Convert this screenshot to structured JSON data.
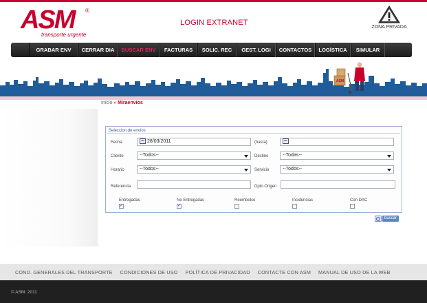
{
  "header": {
    "logo_text": "ASM",
    "logo_reg": "®",
    "logo_tagline": "transporte urgente",
    "title": "LOGIN EXTRANET",
    "zona_label": "ZONA PRIVADA",
    "zona_icon": "warning-icon"
  },
  "nav": {
    "items": [
      {
        "label": "GRABAR ENV",
        "active": false
      },
      {
        "label": "CERRAR DIA",
        "active": false
      },
      {
        "label": "BUSCAR ENV",
        "active": true
      },
      {
        "label": "FACTURAS",
        "active": false
      },
      {
        "label": "SOLIC. REC",
        "active": false
      },
      {
        "label": "GEST. LOGI",
        "active": false
      },
      {
        "label": "CONTACTOS",
        "active": false
      },
      {
        "label": "LOGÍSTICA",
        "active": false
      },
      {
        "label": "SIMULAR",
        "active": false
      }
    ]
  },
  "breadcrumb": {
    "home": "Inicio",
    "separator": "»",
    "current": "Miraenvios"
  },
  "form": {
    "legend": "Seleccion de envíos",
    "fecha_label": "Fecha",
    "fecha_value": "28/03/2011",
    "hasta_label": "(hasta)",
    "hasta_value": "",
    "cliente_label": "Cliente",
    "cliente_value": "--Todos--",
    "destino_label": "Destino",
    "destino_value": "--Todas--",
    "horario_label": "Horario",
    "horario_value": "--Todos--",
    "servicio_label": "Servicio",
    "servicio_value": "--Todos--",
    "referencia_label": "Referencia",
    "referencia_value": "",
    "dpto_label": "Dpto Origen",
    "dpto_value": "",
    "checkboxes": [
      {
        "label": "Entregadas",
        "checked": true
      },
      {
        "label": "No Entregadas",
        "checked": true
      },
      {
        "label": "Reembolso",
        "checked": false
      },
      {
        "label": "Incidencias",
        "checked": false
      },
      {
        "label": "Con DAC",
        "checked": false
      }
    ],
    "search_button": "buscar"
  },
  "footer": {
    "links": [
      "COND. GENERALES DEL TRANSPORTE",
      "CONDICIONES DE USO",
      "POLÍTICA DE PRIVACIDAD",
      "CONTACTE CON ASM",
      "MANUAL DE USO DE LA WEB"
    ],
    "copyright": "© ASM. 2011"
  },
  "colors": {
    "brand_red": "#c8002d",
    "nav_dark": "#262626",
    "active_nav": "#e3245a",
    "skyline": "#1f5c99",
    "form_border": "#9bb0d1"
  }
}
